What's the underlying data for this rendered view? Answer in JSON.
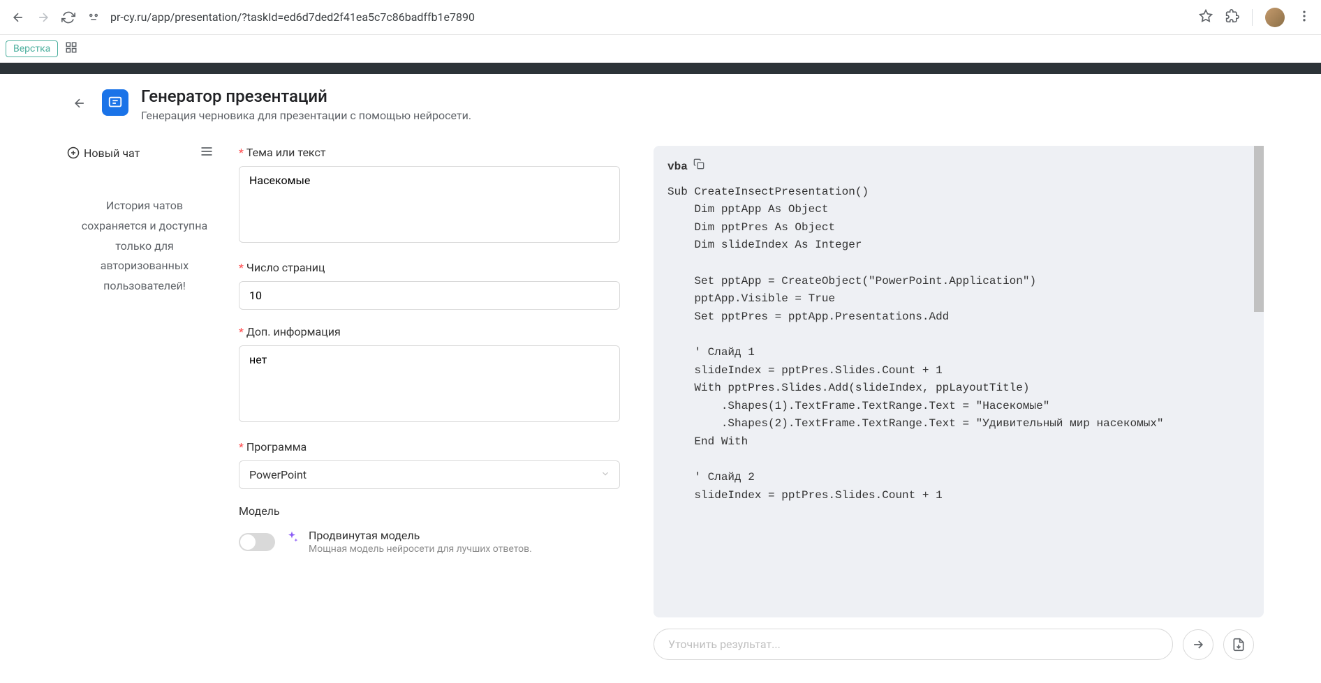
{
  "browser": {
    "url": "pr-cy.ru/app/presentation/?taskId=ed6d7ded2f41ea5c7c86badffb1e7890"
  },
  "bookmarks": {
    "item1": "Верстка"
  },
  "header": {
    "title": "Генератор презентаций",
    "subtitle": "Генерация черновика для презентации с помощью нейросети."
  },
  "sidebar": {
    "new_chat": "Новый чат",
    "message": "История чатов сохраняется и доступна только для авторизованных пользователей!"
  },
  "form": {
    "topic_label": "Тема или текст",
    "topic_value": "Насекомые",
    "pages_label": "Число страниц",
    "pages_value": "10",
    "extra_label": "Доп. информация",
    "extra_value": "нет",
    "program_label": "Программа",
    "program_value": "PowerPoint",
    "model_label": "Модель",
    "advanced_title": "Продвинутая модель",
    "advanced_sub": "Мощная модель нейросети для лучших ответов."
  },
  "output": {
    "lang": "vba",
    "code": "Sub CreateInsectPresentation()\n    Dim pptApp As Object\n    Dim pptPres As Object\n    Dim slideIndex As Integer\n\n    Set pptApp = CreateObject(\"PowerPoint.Application\")\n    pptApp.Visible = True\n    Set pptPres = pptApp.Presentations.Add\n\n    ' Слайд 1\n    slideIndex = pptPres.Slides.Count + 1\n    With pptPres.Slides.Add(slideIndex, ppLayoutTitle)\n        .Shapes(1).TextFrame.TextRange.Text = \"Насекомые\"\n        .Shapes(2).TextFrame.TextRange.Text = \"Удивительный мир насекомых\"\n    End With\n\n    ' Слайд 2\n    slideIndex = pptPres.Slides.Count + 1",
    "refine_placeholder": "Уточнить результат..."
  }
}
